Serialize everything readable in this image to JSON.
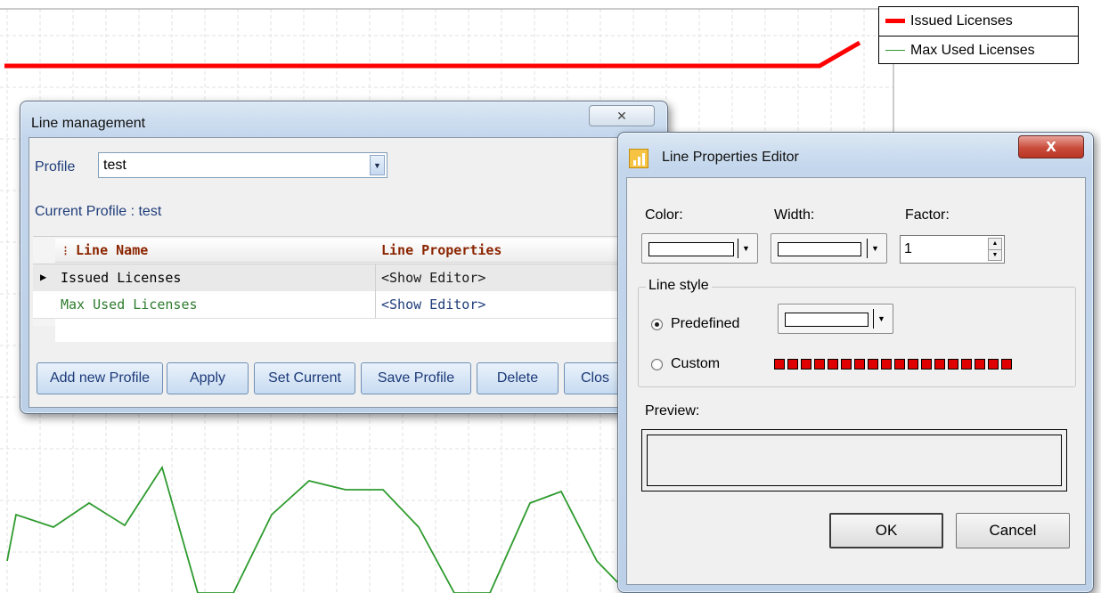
{
  "chart": {
    "legend": [
      {
        "label": "Issued Licenses",
        "color": "#ff0000"
      },
      {
        "label": "Max Used Licenses",
        "color": "#2e9b2e"
      }
    ]
  },
  "line_management": {
    "title": "Line management",
    "close_glyph": "✕",
    "profile_label": "Profile",
    "profile_value": "test",
    "current_profile_text": "Current Profile : test",
    "grid": {
      "columns": [
        "Line Name",
        "Line Properties"
      ],
      "rows": [
        {
          "name": "Issued Licenses",
          "props": "<Show Editor>",
          "name_color": "#000000",
          "selected": true
        },
        {
          "name": "Max Used Licenses",
          "props": "<Show Editor>",
          "name_color": "#2e7d2e",
          "selected": false
        }
      ]
    },
    "buttons": [
      "Add new Profile",
      "Apply",
      "Set Current",
      "Save Profile",
      "Delete",
      "Clos"
    ]
  },
  "line_properties_editor": {
    "title": "Line Properties Editor",
    "close_glyph": "X",
    "color_label": "Color:",
    "width_label": "Width:",
    "factor_label": "Factor:",
    "factor_value": "1",
    "line_style_label": "Line style",
    "predefined_label": "Predefined",
    "custom_label": "Custom",
    "selected_style": "Predefined",
    "custom_pattern_segments": 18,
    "preview_label": "Preview:",
    "ok_label": "OK",
    "cancel_label": "Cancel"
  },
  "colors": {
    "issued_line": "#ff0000",
    "max_used_line": "#2e9b2e",
    "accent_blue": "#1f3d7a"
  }
}
